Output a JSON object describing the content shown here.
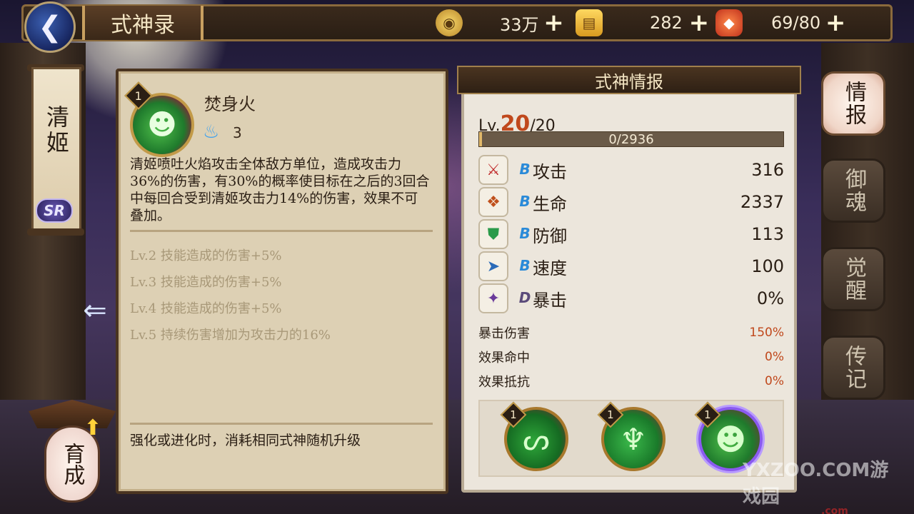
{
  "header": {
    "title": "式神录",
    "currencies": [
      {
        "icon": "coin-icon",
        "value": "33万"
      },
      {
        "icon": "jade-icon",
        "value": "282"
      },
      {
        "icon": "stamina-icon",
        "value": "69/80"
      }
    ]
  },
  "shikigami": {
    "name": "清姬",
    "rarity": "SR"
  },
  "skill_detail": {
    "level_badge": "1",
    "name": "焚身火",
    "cost": "3",
    "description": "清姬喷吐火焰攻击全体敌方单位，造成攻击力36%的伤害，有30%的概率使目标在之后的3回合中每回合受到清姬攻击力14%的伤害，效果不可叠加。",
    "levels": [
      "Lv.2  技能造成的伤害+5%",
      "Lv.3  技能造成的伤害+5%",
      "Lv.4  技能造成的伤害+5%",
      "Lv.5  持续伤害增加为攻击力的16%"
    ],
    "note": "强化或进化时，消耗相同式神随机升级"
  },
  "info": {
    "header": "式神情报",
    "lv_prefix": "Lv.",
    "level": "20",
    "level_max": "/20",
    "exp_text": "0/2936",
    "exp_fraction": 0.005,
    "stats": [
      {
        "icon": "attack-icon",
        "grade": "B",
        "name": "攻击",
        "value": "316"
      },
      {
        "icon": "health-icon",
        "grade": "B",
        "name": "生命",
        "value": "2337"
      },
      {
        "icon": "defense-icon",
        "grade": "B",
        "name": "防御",
        "value": "113"
      },
      {
        "icon": "speed-icon",
        "grade": "B",
        "name": "速度",
        "value": "100"
      },
      {
        "icon": "crit-icon",
        "grade": "D",
        "name": "暴击",
        "value": "0%"
      }
    ],
    "sub_stats": [
      {
        "name": "暴击伤害",
        "value": "150%"
      },
      {
        "name": "效果命中",
        "value": "0%"
      },
      {
        "name": "效果抵抗",
        "value": "0%"
      }
    ],
    "skill_slots": [
      {
        "badge": "1",
        "icon": "swirl-skill-icon"
      },
      {
        "badge": "1",
        "icon": "flame-skill-icon"
      },
      {
        "badge": "1",
        "icon": "burning-body-skill-icon"
      }
    ]
  },
  "tabs": [
    "情报",
    "御魂",
    "觉醒",
    "传记"
  ],
  "grow_button": "育成",
  "watermark": {
    "main": "YXZOO.COM游戏园",
    "sub": ".com"
  },
  "colors": {
    "accent": "#c0481c",
    "panel": "#ddd0b4",
    "frame": "#4a3420",
    "grade_b": "#2a8ad8",
    "grade_d": "#5a4a7a"
  }
}
